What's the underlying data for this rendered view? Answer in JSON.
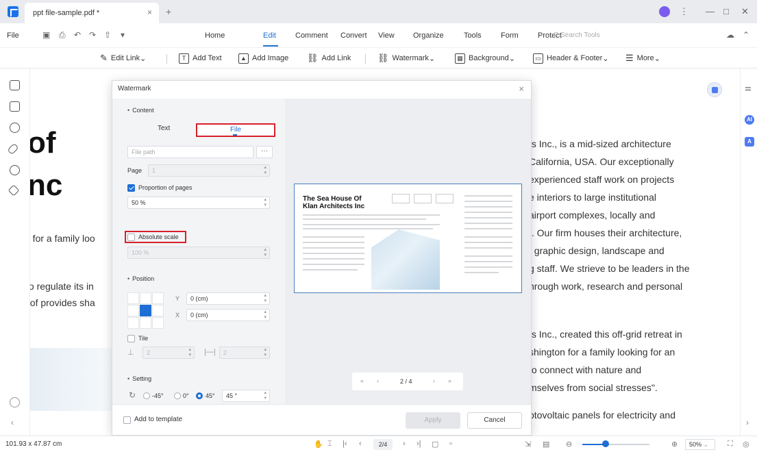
{
  "tab": {
    "title": "ppt file-sample.pdf *",
    "close": "×",
    "add": "+"
  },
  "window": {
    "minimize": "—",
    "maximize": "□",
    "close": "✕",
    "more": "⋮"
  },
  "menu": {
    "file": "File",
    "items": [
      "Home",
      "Edit",
      "Comment",
      "Convert",
      "View",
      "Organize",
      "Tools",
      "Form",
      "Protect"
    ],
    "active": "Edit",
    "search_placeholder": "Search Tools"
  },
  "toolbar": {
    "edit_link": "Edit Link",
    "add_text": "Add Text",
    "add_image": "Add Image",
    "add_link": "Add Link",
    "watermark": "Watermark",
    "background": "Background",
    "header_footer": "Header & Footer",
    "more": "More"
  },
  "document": {
    "big_title_1": "of",
    "big_title_2": "nc",
    "left_lines": [
      "n for a family loo",
      "to regulate its in",
      "oof provides sha"
    ],
    "right_para_1": [
      "ts Inc., is a mid-sized architecture",
      "California, USA. Our exceptionally",
      "experienced staff work on projects",
      "e interiors to large institutional",
      "airport complexes, locally and",
      "/. Our firm houses their architecture,",
      ", graphic design, landscape and",
      "g staff. We strieve to be leaders in the",
      "hrough work, research and personal"
    ],
    "right_para_2": [
      "ts Inc., created this off-grid retreat in",
      "shington for a family looking for an",
      "to connect with nature and",
      "mselves from social stresses\".",
      "otovoltaic panels for electricity and"
    ]
  },
  "dialog": {
    "title": "Watermark",
    "close": "×",
    "content_section": "Content",
    "tab_text": "Text",
    "tab_file": "File",
    "file_path_placeholder": "File path",
    "browse": "···",
    "page_label": "Page",
    "page_value": "1",
    "proportion_label": "Proportion of pages",
    "proportion_value": "50 %",
    "absolute_label": "Absolute scale",
    "absolute_value": "100 %",
    "position_section": "Position",
    "y_label": "Y",
    "y_value": "0 (cm)",
    "x_label": "X",
    "x_value": "0 (cm)",
    "tile_label": "Tile",
    "tile_v1": "2",
    "tile_v2": "2",
    "setting_section": "Setting",
    "rot_neg45": "-45°",
    "rot_0": "0°",
    "rot_45": "45°",
    "rot_value": "45 °",
    "preview_title_1": "The Sea House Of",
    "preview_title_2": "Klan Architects Inc",
    "page_indicator": "2 / 4",
    "add_to_template": "Add to template",
    "apply": "Apply",
    "cancel": "Cancel"
  },
  "status": {
    "dimensions": "101.93 x 47.87 cm",
    "page": "2/4",
    "zoom": "50%",
    "zoom_fraction": 0.35
  }
}
